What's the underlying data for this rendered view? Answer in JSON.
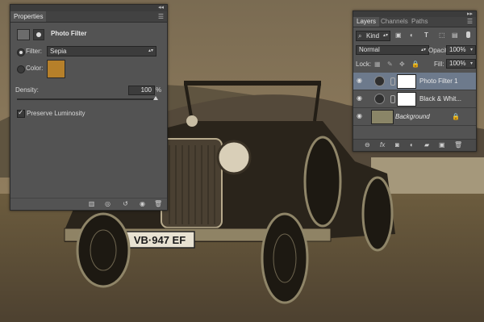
{
  "properties": {
    "tab": "Properties",
    "title": "Photo Filter",
    "filter_label": "Filter:",
    "filter_value": "Sepia",
    "color_label": "Color:",
    "color": "#b6802a",
    "density_label": "Density:",
    "density_value": "100",
    "density_unit": "%",
    "density_level": 1.0,
    "preserve_label": "Preserve Luminosity"
  },
  "layers_panel": {
    "tabs": [
      "Layers",
      "Channels",
      "Paths"
    ],
    "kind_label": "Kind",
    "blend_mode": "Normal",
    "opacity_label": "Opacity:",
    "opacity_value": "100%",
    "lock_label": "Lock:",
    "fill_label": "Fill:",
    "fill_value": "100%",
    "layers": [
      {
        "name": "Photo Filter 1",
        "selected": true
      },
      {
        "name": "Black & Whit...",
        "selected": false
      },
      {
        "name": "Background",
        "selected": false
      }
    ]
  },
  "photo": {
    "license_plate": "VB·947 EF"
  },
  "colors": {
    "panel": "#535353",
    "selected_layer": "#6d7a8c",
    "sepia": "#b6802a"
  }
}
